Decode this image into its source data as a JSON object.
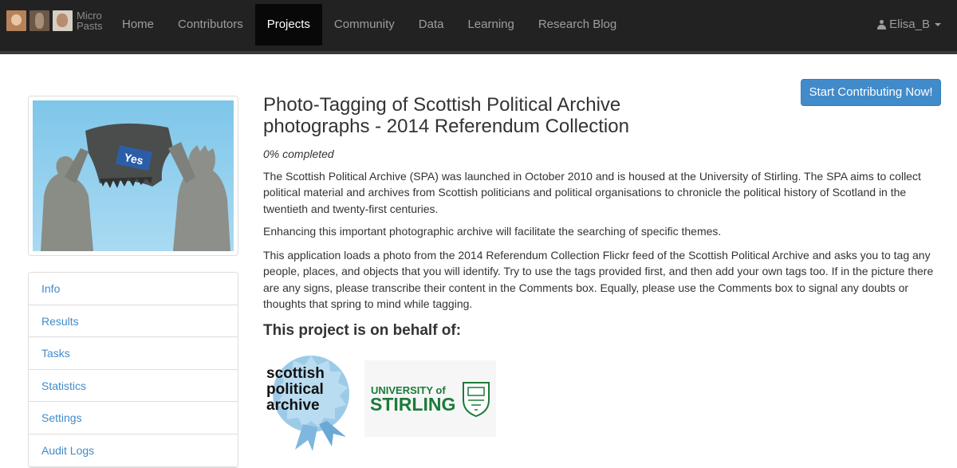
{
  "navbar": {
    "brand_line1": "Micro",
    "brand_line2": "Pasts",
    "items": [
      {
        "label": "Home",
        "active": false
      },
      {
        "label": "Contributors",
        "active": false
      },
      {
        "label": "Projects",
        "active": true
      },
      {
        "label": "Community",
        "active": false
      },
      {
        "label": "Data",
        "active": false
      },
      {
        "label": "Learning",
        "active": false
      },
      {
        "label": "Research Blog",
        "active": false
      }
    ],
    "user": "Elisa_B"
  },
  "sidebar": {
    "image_sign_text": "Yes",
    "items": [
      "Info",
      "Results",
      "Tasks",
      "Statistics",
      "Settings",
      "Audit Logs"
    ]
  },
  "project": {
    "title": "Photo-Tagging of Scottish Political Archive photographs - 2014 Referendum Collection",
    "completed": "0% completed",
    "start_button": "Start Contributing Now!",
    "paragraphs": [
      "The Scottish Political Archive (SPA) was launched in October 2010 and is housed at the University of Stirling. The SPA aims to collect political material and archives from Scottish politicians and political organisations to chronicle the political history of Scotland in the twentieth and twenty-first centuries.",
      "Enhancing this important photographic archive will facilitate the searching of specific themes.",
      "This application loads a photo from the 2014 Referendum Collection Flickr feed of the Scottish Political Archive and asks you to tag any people, places, and objects that you will identify. Try to use the tags provided first, and then add your own tags too. If in the picture there are any signs, please transcribe their content in the Comments box. Equally, please use the Comments box to signal any doubts or thoughts that spring to mind while tagging."
    ],
    "behalf_heading": "This project is on behalf of:",
    "partners": {
      "spa_line1": "scottish",
      "spa_line2": "political",
      "spa_line3": "archive",
      "stirling_line1": "UNIVERSITY of",
      "stirling_line2": "STIRLING"
    }
  },
  "colors": {
    "navbar_bg": "#222222",
    "link": "#428bca",
    "stirling_green": "#1b7b3a",
    "spa_blue": "#8fbfe0"
  }
}
